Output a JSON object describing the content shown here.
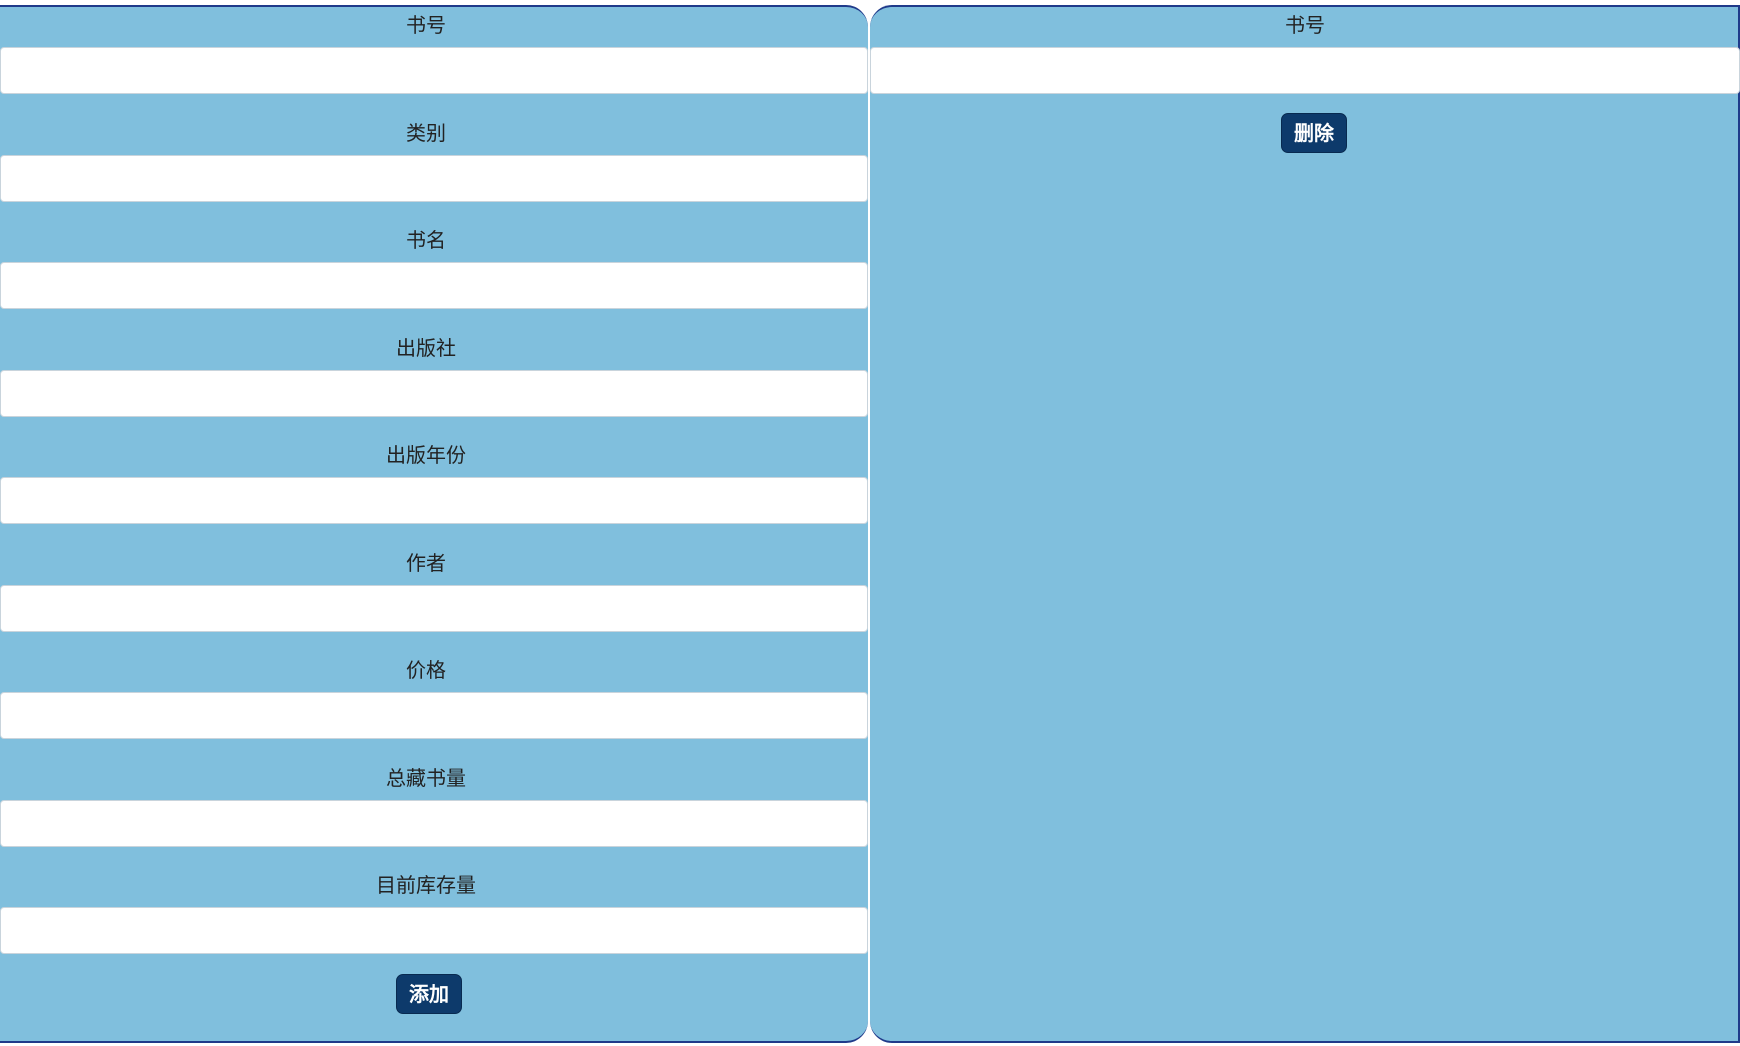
{
  "colors": {
    "panel_bg": "#80bfdd",
    "button_bg": "#0d3a6b",
    "border": "#1f3a8a"
  },
  "add_form": {
    "fields": [
      {
        "label": "书号",
        "value": "",
        "placeholder": ""
      },
      {
        "label": "类别",
        "value": "",
        "placeholder": ""
      },
      {
        "label": "书名",
        "value": "",
        "placeholder": ""
      },
      {
        "label": "出版社",
        "value": "",
        "placeholder": ""
      },
      {
        "label": "出版年份",
        "value": "",
        "placeholder": ""
      },
      {
        "label": "作者",
        "value": "",
        "placeholder": ""
      },
      {
        "label": "价格",
        "value": "",
        "placeholder": ""
      },
      {
        "label": "总藏书量",
        "value": "",
        "placeholder": ""
      },
      {
        "label": "目前库存量",
        "value": "",
        "placeholder": ""
      }
    ],
    "submit_label": "添加"
  },
  "delete_form": {
    "fields": [
      {
        "label": "书号",
        "value": "",
        "placeholder": ""
      }
    ],
    "submit_label": "删除"
  }
}
